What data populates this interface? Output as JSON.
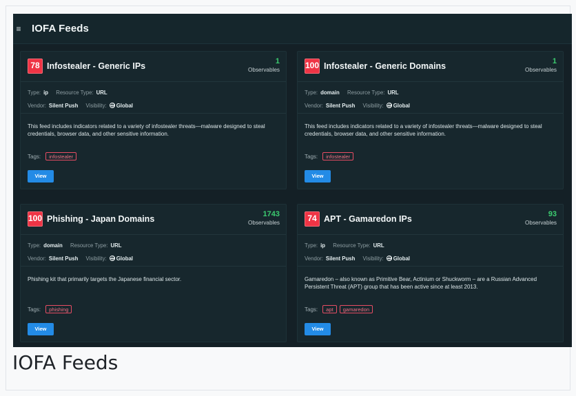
{
  "app": {
    "title": "IOFA Feeds",
    "menu_icon": "hamburger-menu-icon"
  },
  "cards": [
    {
      "score": "78",
      "title": "Infostealer - Generic IPs",
      "observables_count": "1",
      "observables_label": "Observables",
      "type_label": "Type:",
      "type_value": "ip",
      "resource_type_label": "Resource Type:",
      "resource_type_value": "URL",
      "vendor_label": "Vendor:",
      "vendor_value": "Silent Push",
      "visibility_label": "Visibility:",
      "visibility_value": "Global",
      "description": "This feed includes indicators related to a variety of infostealer threats—malware designed to steal credentials, browser data, and other sensitive information.",
      "tags_label": "Tags:",
      "tags": [
        "infostealer"
      ],
      "button_label": "View"
    },
    {
      "score": "100",
      "title": "Infostealer - Generic Domains",
      "observables_count": "1",
      "observables_label": "Observables",
      "type_label": "Type:",
      "type_value": "domain",
      "resource_type_label": "Resource Type:",
      "resource_type_value": "URL",
      "vendor_label": "Vendor:",
      "vendor_value": "Silent Push",
      "visibility_label": "Visibility:",
      "visibility_value": "Global",
      "description": "This feed includes indicators related to a variety of infostealer threats—malware designed to steal credentials, browser data, and other sensitive information.",
      "tags_label": "Tags:",
      "tags": [
        "infostealer"
      ],
      "button_label": "View"
    },
    {
      "score": "100",
      "title": "Phishing - Japan Domains",
      "observables_count": "1743",
      "observables_label": "Observables",
      "type_label": "Type:",
      "type_value": "domain",
      "resource_type_label": "Resource Type:",
      "resource_type_value": "URL",
      "vendor_label": "Vendor:",
      "vendor_value": "Silent Push",
      "visibility_label": "Visibility:",
      "visibility_value": "Global",
      "description": "Phishing kit that primarily targets the Japanese financial sector.",
      "tags_label": "Tags:",
      "tags": [
        "phishing"
      ],
      "button_label": "View"
    },
    {
      "score": "74",
      "title": "APT - Gamaredon IPs",
      "observables_count": "93",
      "observables_label": "Observables",
      "type_label": "Type:",
      "type_value": "ip",
      "resource_type_label": "Resource Type:",
      "resource_type_value": "URL",
      "vendor_label": "Vendor:",
      "vendor_value": "Silent Push",
      "visibility_label": "Visibility:",
      "visibility_value": "Global",
      "description": "Gamaredon – also known as Primitive Bear, Actinium or Shuckworm – are a Russian Advanced Persistent Threat (APT) group that has been active since at least 2013.",
      "tags_label": "Tags:",
      "tags": [
        "apt",
        "gamaredon"
      ],
      "button_label": "View"
    }
  ],
  "caption": {
    "text": "IOFA Feeds"
  },
  "colors": {
    "background": "#142026",
    "card": "#17272d",
    "score_badge": "#ef3445",
    "observables_count": "#3ccc70",
    "tag_border": "#e94d64",
    "button": "#238be6"
  }
}
